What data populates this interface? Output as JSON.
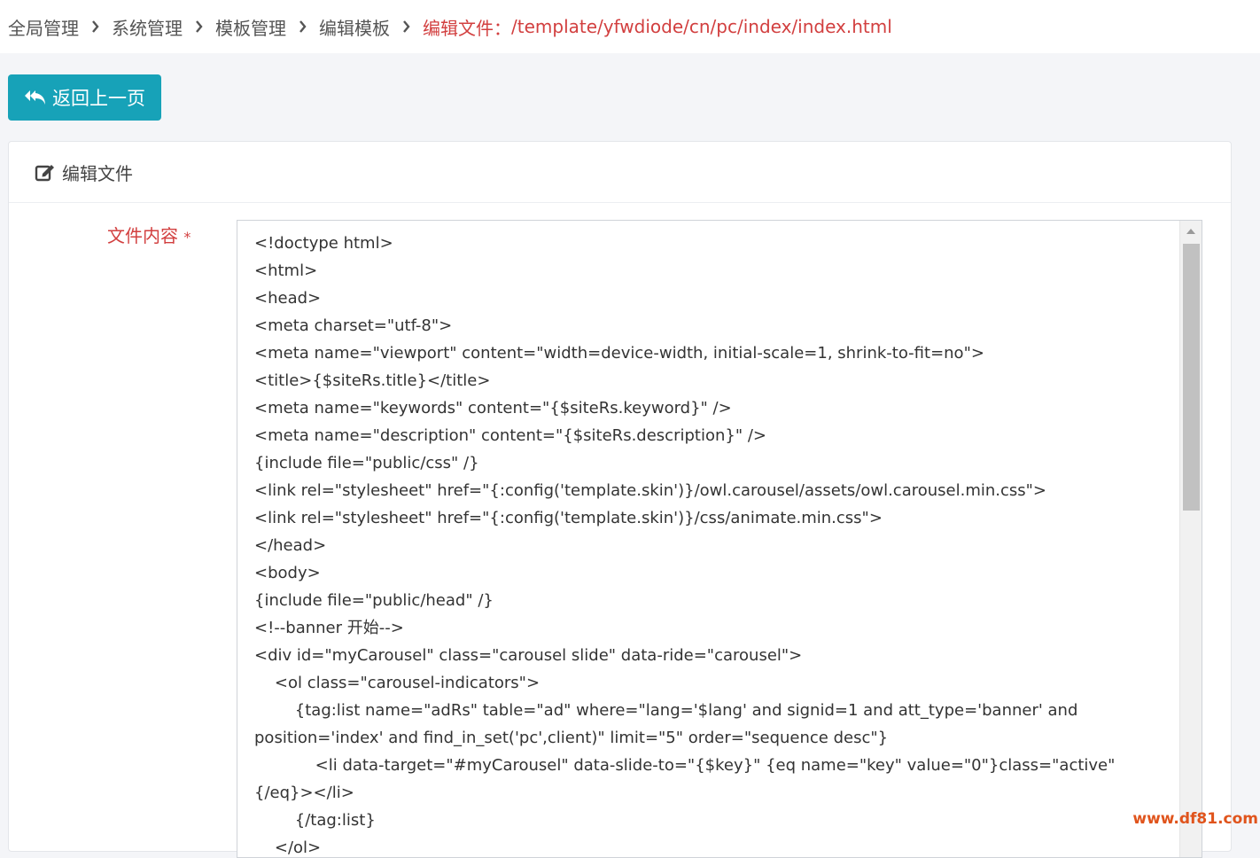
{
  "breadcrumb": {
    "items": [
      "全局管理",
      "系统管理",
      "模板管理",
      "编辑模板"
    ],
    "current_label": "编辑文件：",
    "current_path": "/template/yfwdiode/cn/pc/index/index.html"
  },
  "back_button": {
    "label": "返回上一页",
    "icon": "reply-all-icon"
  },
  "card": {
    "title": "编辑文件",
    "title_icon": "edit-icon"
  },
  "form": {
    "field_label": "文件内容",
    "required_mark": "*",
    "code_lines": [
      "<!doctype html>",
      "<html>",
      "<head>",
      "<meta charset=\"utf-8\">",
      "<meta name=\"viewport\" content=\"width=device-width, initial-scale=1, shrink-to-fit=no\">",
      "<title>{$siteRs.title}</title>",
      "<meta name=\"keywords\" content=\"{$siteRs.keyword}\" />",
      "<meta name=\"description\" content=\"{$siteRs.description}\" />",
      "{include file=\"public/css\" /}",
      "<link rel=\"stylesheet\" href=\"{:config('template.skin')}/owl.carousel/assets/owl.carousel.min.css\">",
      "<link rel=\"stylesheet\" href=\"{:config('template.skin')}/css/animate.min.css\">",
      "</head>",
      "<body>",
      "{include file=\"public/head\" /}",
      "<!--banner 开始-->",
      "<div id=\"myCarousel\" class=\"carousel slide\" data-ride=\"carousel\">",
      "    <ol class=\"carousel-indicators\">",
      "        {tag:list name=\"adRs\" table=\"ad\" where=\"lang='$lang' and signid=1 and att_type='banner' and position='index' and find_in_set('pc',client)\" limit=\"5\" order=\"sequence desc\"}",
      "            <li data-target=\"#myCarousel\" data-slide-to=\"{$key}\" {eq name=\"key\" value=\"0\"}class=\"active\"{/eq}></li>",
      "        {/tag:list}",
      "    </ol>"
    ]
  },
  "watermark": "www.df81.com",
  "colors": {
    "accent": "#17a2b8",
    "danger_text": "#d23f3f",
    "page_bg": "#f4f5f8"
  }
}
